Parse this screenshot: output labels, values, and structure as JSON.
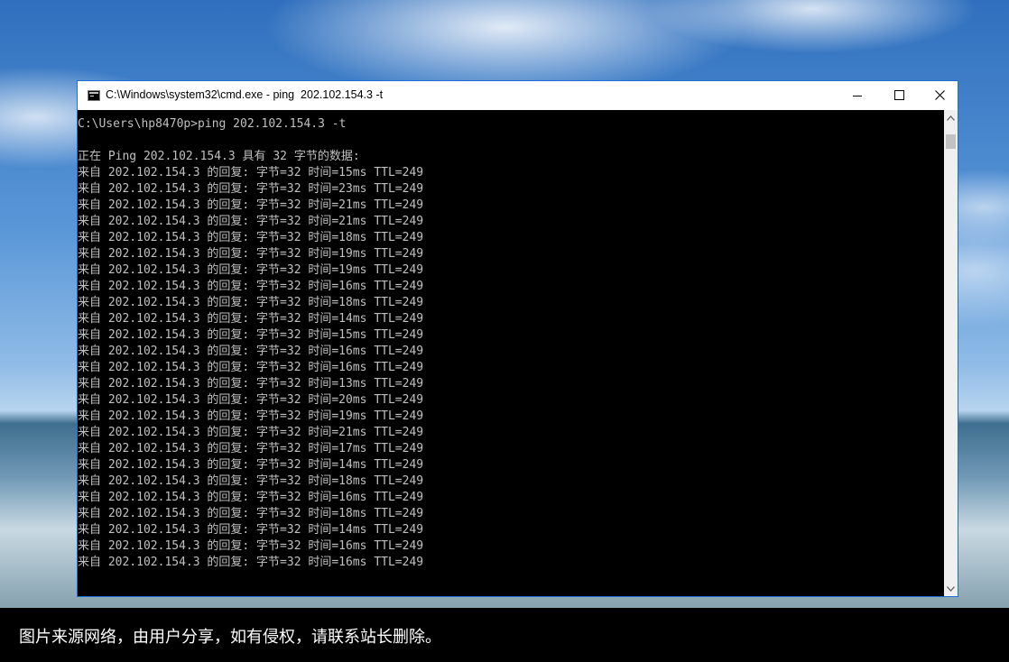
{
  "window": {
    "title": "C:\\Windows\\system32\\cmd.exe - ping  202.102.154.3 -t",
    "icon": "console-icon",
    "controls": [
      "minimize-icon",
      "maximize-icon",
      "close-icon"
    ],
    "border_color": "#1d6fd6"
  },
  "console": {
    "text_color": "#c0c0c0",
    "background": "#000000",
    "lines": [
      "C:\\Users\\hp8470p>ping 202.102.154.3 -t",
      "",
      "正在 Ping 202.102.154.3 具有 32 字节的数据:",
      "来自 202.102.154.3 的回复: 字节=32 时间=15ms TTL=249",
      "来自 202.102.154.3 的回复: 字节=32 时间=23ms TTL=249",
      "来自 202.102.154.3 的回复: 字节=32 时间=21ms TTL=249",
      "来自 202.102.154.3 的回复: 字节=32 时间=21ms TTL=249",
      "来自 202.102.154.3 的回复: 字节=32 时间=18ms TTL=249",
      "来自 202.102.154.3 的回复: 字节=32 时间=19ms TTL=249",
      "来自 202.102.154.3 的回复: 字节=32 时间=19ms TTL=249",
      "来自 202.102.154.3 的回复: 字节=32 时间=16ms TTL=249",
      "来自 202.102.154.3 的回复: 字节=32 时间=18ms TTL=249",
      "来自 202.102.154.3 的回复: 字节=32 时间=14ms TTL=249",
      "来自 202.102.154.3 的回复: 字节=32 时间=15ms TTL=249",
      "来自 202.102.154.3 的回复: 字节=32 时间=16ms TTL=249",
      "来自 202.102.154.3 的回复: 字节=32 时间=16ms TTL=249",
      "来自 202.102.154.3 的回复: 字节=32 时间=13ms TTL=249",
      "来自 202.102.154.3 的回复: 字节=32 时间=20ms TTL=249",
      "来自 202.102.154.3 的回复: 字节=32 时间=19ms TTL=249",
      "来自 202.102.154.3 的回复: 字节=32 时间=21ms TTL=249",
      "来自 202.102.154.3 的回复: 字节=32 时间=17ms TTL=249",
      "来自 202.102.154.3 的回复: 字节=32 时间=14ms TTL=249",
      "来自 202.102.154.3 的回复: 字节=32 时间=18ms TTL=249",
      "来自 202.102.154.3 的回复: 字节=32 时间=16ms TTL=249",
      "来自 202.102.154.3 的回复: 字节=32 时间=18ms TTL=249",
      "来自 202.102.154.3 的回复: 字节=32 时间=14ms TTL=249",
      "来自 202.102.154.3 的回复: 字节=32 时间=16ms TTL=249",
      "来自 202.102.154.3 的回复: 字节=32 时间=16ms TTL=249"
    ]
  },
  "scrollbar": {
    "up_icon": "scroll-up-arrow-icon",
    "down_icon": "scroll-down-arrow-icon"
  },
  "caption": {
    "text": "图片来源网络，由用户分享，如有侵权，请联系站长删除。"
  }
}
